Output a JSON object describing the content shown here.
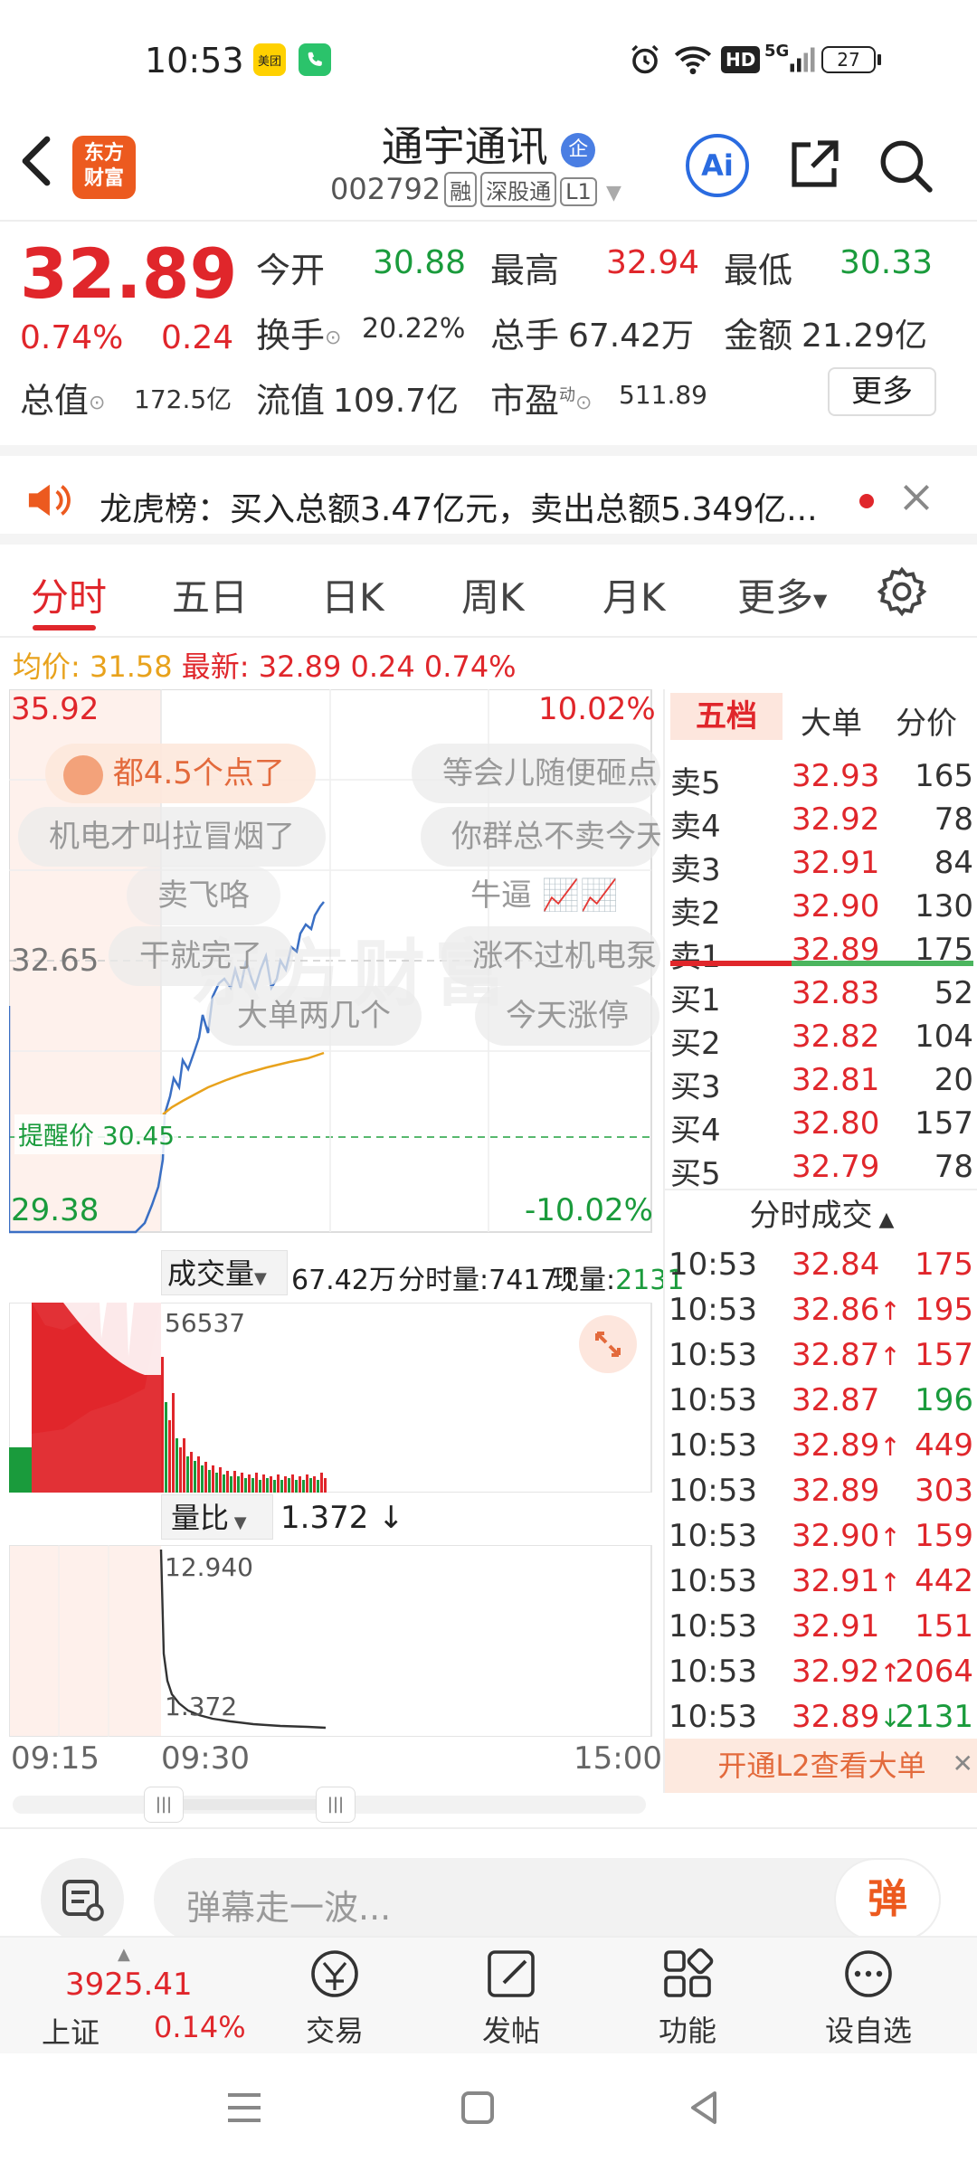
{
  "status_bar": {
    "time": "10:53",
    "apps": [
      "美团",
      "phone-app"
    ],
    "battery": "27",
    "network": "5G",
    "hd": "HD"
  },
  "header": {
    "stock_name": "通宇通讯",
    "badge": "企",
    "code": "002792",
    "tags": [
      "融",
      "深股通",
      "L1"
    ],
    "logo_text": "东方财富",
    "ai_label": "Ai"
  },
  "quote": {
    "price": "32.89",
    "change_pct": "0.74%",
    "change": "0.24",
    "open_label": "今开",
    "open": "30.88",
    "high_label": "最高",
    "high": "32.94",
    "low_label": "最低",
    "low": "30.33",
    "turnover_label": "换手",
    "turnover": "20.22%",
    "volume_label": "总手",
    "volume": "67.42万",
    "amount_label": "金额",
    "amount": "21.29亿",
    "mktcap_label": "总值",
    "mktcap": "172.5亿",
    "float_label": "流值",
    "float": "109.7亿",
    "pe_label": "市盈",
    "pe_sup": "动",
    "pe": "511.89",
    "more": "更多"
  },
  "banner": {
    "text": "龙虎榜：买入总额3.47亿元，卖出总额5.349亿..."
  },
  "tabs": [
    "分时",
    "五日",
    "日K",
    "周K",
    "月K",
    "更多"
  ],
  "avg_line": {
    "avg_label": "均价:",
    "avg": "31.58",
    "latest_label": "最新:",
    "latest": "32.89",
    "chg": "0.24",
    "pct": "0.74%"
  },
  "chart": {
    "y_top": "35.92",
    "y_mid": "32.65",
    "y_bottom": "29.38",
    "pct_top": "10.02%",
    "pct_bottom": "-10.02%",
    "alert": "提醒价 30.45",
    "ticker_labels": [
      "卖飞咯",
      "牛逼"
    ],
    "watermark": "东方财富",
    "danmu": [
      "都4.5个点了",
      "等会儿随便砸点",
      "机电才叫拉冒烟了",
      "你群总不卖今天",
      "干就完了",
      "涨不过机电泵",
      "大单两几个",
      "今天涨停"
    ],
    "volume_label": "成交量",
    "volume": "67.42万",
    "fenshi_label": "分时量:",
    "fenshi": "7417",
    "now_label": "现量:",
    "now": "2131",
    "vol_max": "56537",
    "ratio_label": "量比",
    "ratio": "1.372",
    "ratio_max": "12.940",
    "ratio_min": "1.372",
    "times": [
      "09:15",
      "09:30",
      "15:00"
    ]
  },
  "book": {
    "tabs": [
      "五档",
      "大单",
      "分价"
    ],
    "asks": [
      {
        "label": "卖5",
        "price": "32.93",
        "qty": "165"
      },
      {
        "label": "卖4",
        "price": "32.92",
        "qty": "78"
      },
      {
        "label": "卖3",
        "price": "32.91",
        "qty": "84"
      },
      {
        "label": "卖2",
        "price": "32.90",
        "qty": "130"
      },
      {
        "label": "卖1",
        "price": "32.89",
        "qty": "175"
      }
    ],
    "bids": [
      {
        "label": "买1",
        "price": "32.83",
        "qty": "52"
      },
      {
        "label": "买2",
        "price": "32.82",
        "qty": "104"
      },
      {
        "label": "买3",
        "price": "32.81",
        "qty": "20"
      },
      {
        "label": "买4",
        "price": "32.80",
        "qty": "157"
      },
      {
        "label": "买5",
        "price": "32.79",
        "qty": "78"
      }
    ],
    "trades_title": "分时成交",
    "trades": [
      {
        "t": "10:53",
        "p": "32.84",
        "arrow": "",
        "q": "175",
        "c": "#e0262b"
      },
      {
        "t": "10:53",
        "p": "32.86",
        "arrow": "↑",
        "q": "195",
        "c": "#e0262b"
      },
      {
        "t": "10:53",
        "p": "32.87",
        "arrow": "↑",
        "q": "157",
        "c": "#e0262b"
      },
      {
        "t": "10:53",
        "p": "32.87",
        "arrow": "",
        "q": "196",
        "c": "#1a9b3c"
      },
      {
        "t": "10:53",
        "p": "32.89",
        "arrow": "↑",
        "q": "449",
        "c": "#e0262b"
      },
      {
        "t": "10:53",
        "p": "32.89",
        "arrow": "",
        "q": "303",
        "c": "#e0262b"
      },
      {
        "t": "10:53",
        "p": "32.90",
        "arrow": "↑",
        "q": "159",
        "c": "#e0262b"
      },
      {
        "t": "10:53",
        "p": "32.91",
        "arrow": "↑",
        "q": "442",
        "c": "#e0262b"
      },
      {
        "t": "10:53",
        "p": "32.91",
        "arrow": "",
        "q": "151",
        "c": "#e0262b"
      },
      {
        "t": "10:53",
        "p": "32.92",
        "arrow": "↑",
        "q": "2064",
        "c": "#e0262b"
      },
      {
        "t": "10:53",
        "p": "32.89",
        "arrow": "↓",
        "q": "2131",
        "c": "#1a9b3c"
      }
    ],
    "l2_promo": "开通L2查看大单"
  },
  "input": {
    "placeholder": "弹幕走一波...",
    "send": "弹"
  },
  "bottom": {
    "index_value": "3925.41",
    "index_name": "上证",
    "index_pct": "0.14%",
    "items": [
      "交易",
      "发帖",
      "功能",
      "设自选"
    ]
  }
}
